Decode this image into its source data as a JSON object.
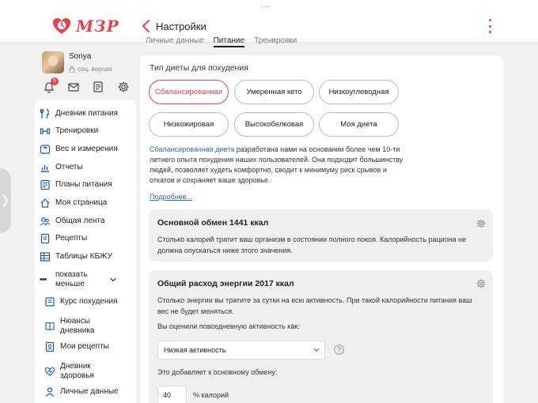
{
  "app": {
    "logo_text": "МЗР",
    "page_title": "Настройки",
    "accent_color": "#e8414e",
    "link_color": "#2f6bb3"
  },
  "profile": {
    "name": "Sonya",
    "version": "соц. версия",
    "notification_count": "5",
    "icons": [
      "bell-icon",
      "mail-icon",
      "notes-icon",
      "gear-icon"
    ]
  },
  "nav": {
    "items": [
      {
        "label": "Дневник питания",
        "icon": "utensils-icon"
      },
      {
        "label": "Тренировки",
        "icon": "dumbbell-icon"
      },
      {
        "label": "Вес и измерения",
        "icon": "scale-icon"
      },
      {
        "label": "Отчеты",
        "icon": "chart-icon"
      },
      {
        "label": "Планы питания",
        "icon": "plan-icon"
      },
      {
        "label": "Моя страница",
        "icon": "home-icon"
      },
      {
        "label": "Общая лента",
        "icon": "feed-icon"
      },
      {
        "label": "Рецепты",
        "icon": "recipe-icon"
      },
      {
        "label": "Таблицы КБЖУ",
        "icon": "table-icon"
      }
    ],
    "toggle_label": "показать меньше",
    "sub_items": [
      {
        "label": "Курс похудения",
        "icon": "course-icon"
      },
      {
        "label": "Нюансы дневника",
        "icon": "book-icon"
      },
      {
        "label": "Мои рецепты",
        "icon": "my-recipes-icon"
      },
      {
        "label": "Дневник здоровья",
        "icon": "heart-icon"
      },
      {
        "label": "Личные данные",
        "icon": "person-icon"
      }
    ]
  },
  "tabs": [
    "Личные данные",
    "Питание",
    "Тренировки"
  ],
  "diet": {
    "section_title": "Тип диеты для похудения",
    "options": [
      "Сбалансированная",
      "Умеренная кето",
      "Низкоуглеводная",
      "Низкожировая",
      "Высокобелковая",
      "Моя диета"
    ],
    "selected": "Сбалансированная",
    "desc_highlight": "Сбалансированная диета",
    "desc_rest": " разработана нами на основании более чем 10-ти летнего опыта похудения наших пользователей. Она подходит большинству людей, позволяет худеть комфортно, сводит к минимуму риск срывов и откатов и сохраняет ваше здоровье.",
    "more_link": "Подробнее..."
  },
  "bmr_card": {
    "title": "Основной обмен 1441 ккал",
    "text": "Столько калорий тратит ваш организм в состоянии полного покоя. Калорийность рациона не должна опускаться ниже этого значения."
  },
  "tdee_card": {
    "title": "Общий расход энергии 2017 ккал",
    "text": "Столько энергии вы тратите за сутки на всю активность. При такой калорийности питания ваш вес не будет меняться.",
    "activity_question": "Вы оценили повседневную активность как:",
    "activity_value": "Низкая активность",
    "adds_label": "Это добавляет к основному обмену:",
    "percent_value": "40",
    "percent_unit": "% калорий"
  }
}
